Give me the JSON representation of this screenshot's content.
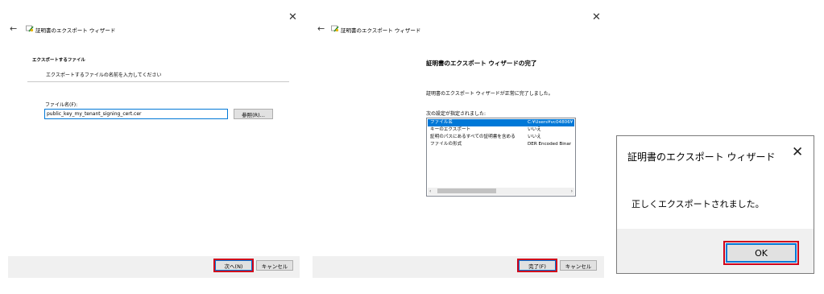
{
  "panel1": {
    "title": "証明書のエクスポート ウィザード",
    "section_heading": "エクスポートするファイル",
    "section_desc": "エクスポートするファイルの名前を入力してください",
    "file_label": "ファイル名(F):",
    "file_value": "public_key_my_tenant_signing_cert.cer",
    "browse_label": "参照(R)...",
    "next_label": "次へ(N)",
    "cancel_label": "キャンセル"
  },
  "panel2": {
    "title": "証明書のエクスポート ウィザード",
    "heading": "証明書のエクスポート ウィザードの完了",
    "message": "証明書のエクスポート ウィザードが正常に完了しました。",
    "settings_label": "次の設定が指定されました:",
    "settings": [
      {
        "name": "ファイル名",
        "value": "C:¥Users¥vc04806¥"
      },
      {
        "name": "キーのエクスポート",
        "value": "いいえ"
      },
      {
        "name": "証明のパスにあるすべての証明書を含める",
        "value": "いいえ"
      },
      {
        "name": "ファイルの形式",
        "value": "DER Encoded Binar"
      }
    ],
    "finish_label": "完了(F)",
    "cancel_label": "キャンセル"
  },
  "dialog": {
    "title": "証明書のエクスポート ウィザード",
    "message": "正しくエクスポートされました。",
    "ok_label": "OK"
  },
  "icons": {
    "close": "close-icon",
    "back": "back-arrow-icon",
    "wizard": "certificate-icon"
  },
  "colors": {
    "highlight": "#d0021b",
    "selection": "#0078d7",
    "footer": "#f0f0f0"
  }
}
